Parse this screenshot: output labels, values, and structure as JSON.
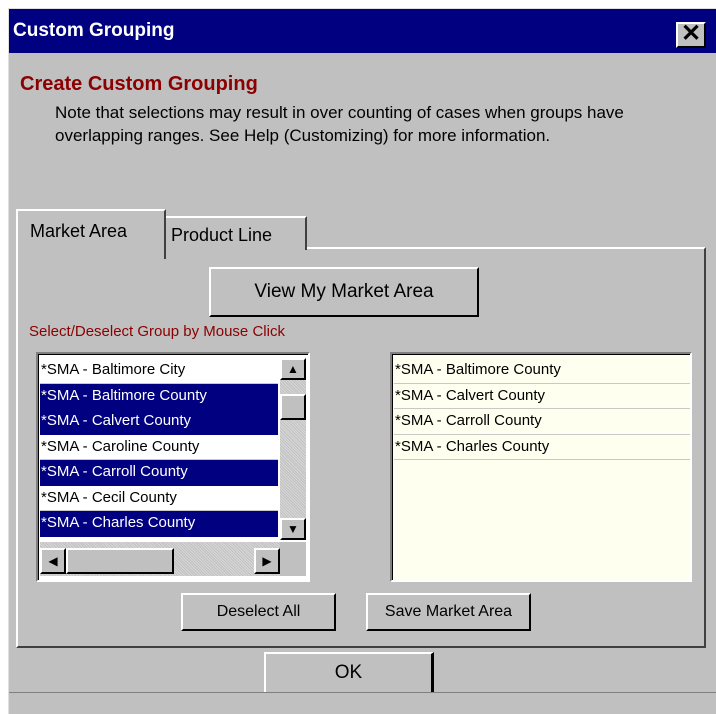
{
  "window": {
    "title": "Custom Grouping",
    "close_glyph": "✕"
  },
  "heading": "Create Custom Grouping",
  "note": "Note that selections may result in over counting of cases when groups have overlapping ranges.  See Help (Customizing) for more information.",
  "tabs": [
    {
      "label": "Market Area",
      "active": true
    },
    {
      "label": "Product Line",
      "active": false
    }
  ],
  "view_button": "View My Market Area",
  "select_label": "Select/Deselect Group by Mouse Click",
  "left_list": [
    {
      "label": "*SMA - Baltimore City",
      "selected": false
    },
    {
      "label": "*SMA - Baltimore County",
      "selected": true
    },
    {
      "label": "*SMA - Calvert County",
      "selected": true
    },
    {
      "label": "*SMA - Caroline County",
      "selected": false
    },
    {
      "label": "*SMA - Carroll County",
      "selected": true
    },
    {
      "label": "*SMA - Cecil County",
      "selected": false
    },
    {
      "label": "*SMA - Charles County",
      "selected": true
    }
  ],
  "right_list": [
    "*SMA - Baltimore County",
    "*SMA - Calvert County",
    "*SMA - Carroll County",
    "*SMA - Charles County"
  ],
  "scroll_glyphs": {
    "up": "▲",
    "down": "▼",
    "left": "◀",
    "right": "▶"
  },
  "deselect_button": "Deselect All",
  "save_button": "Save Market Area",
  "ok_button": "OK",
  "colors": {
    "title_bar": "#000080",
    "heading": "#8b0000",
    "selection": "#000080",
    "dialog": "#c0c0c0"
  }
}
